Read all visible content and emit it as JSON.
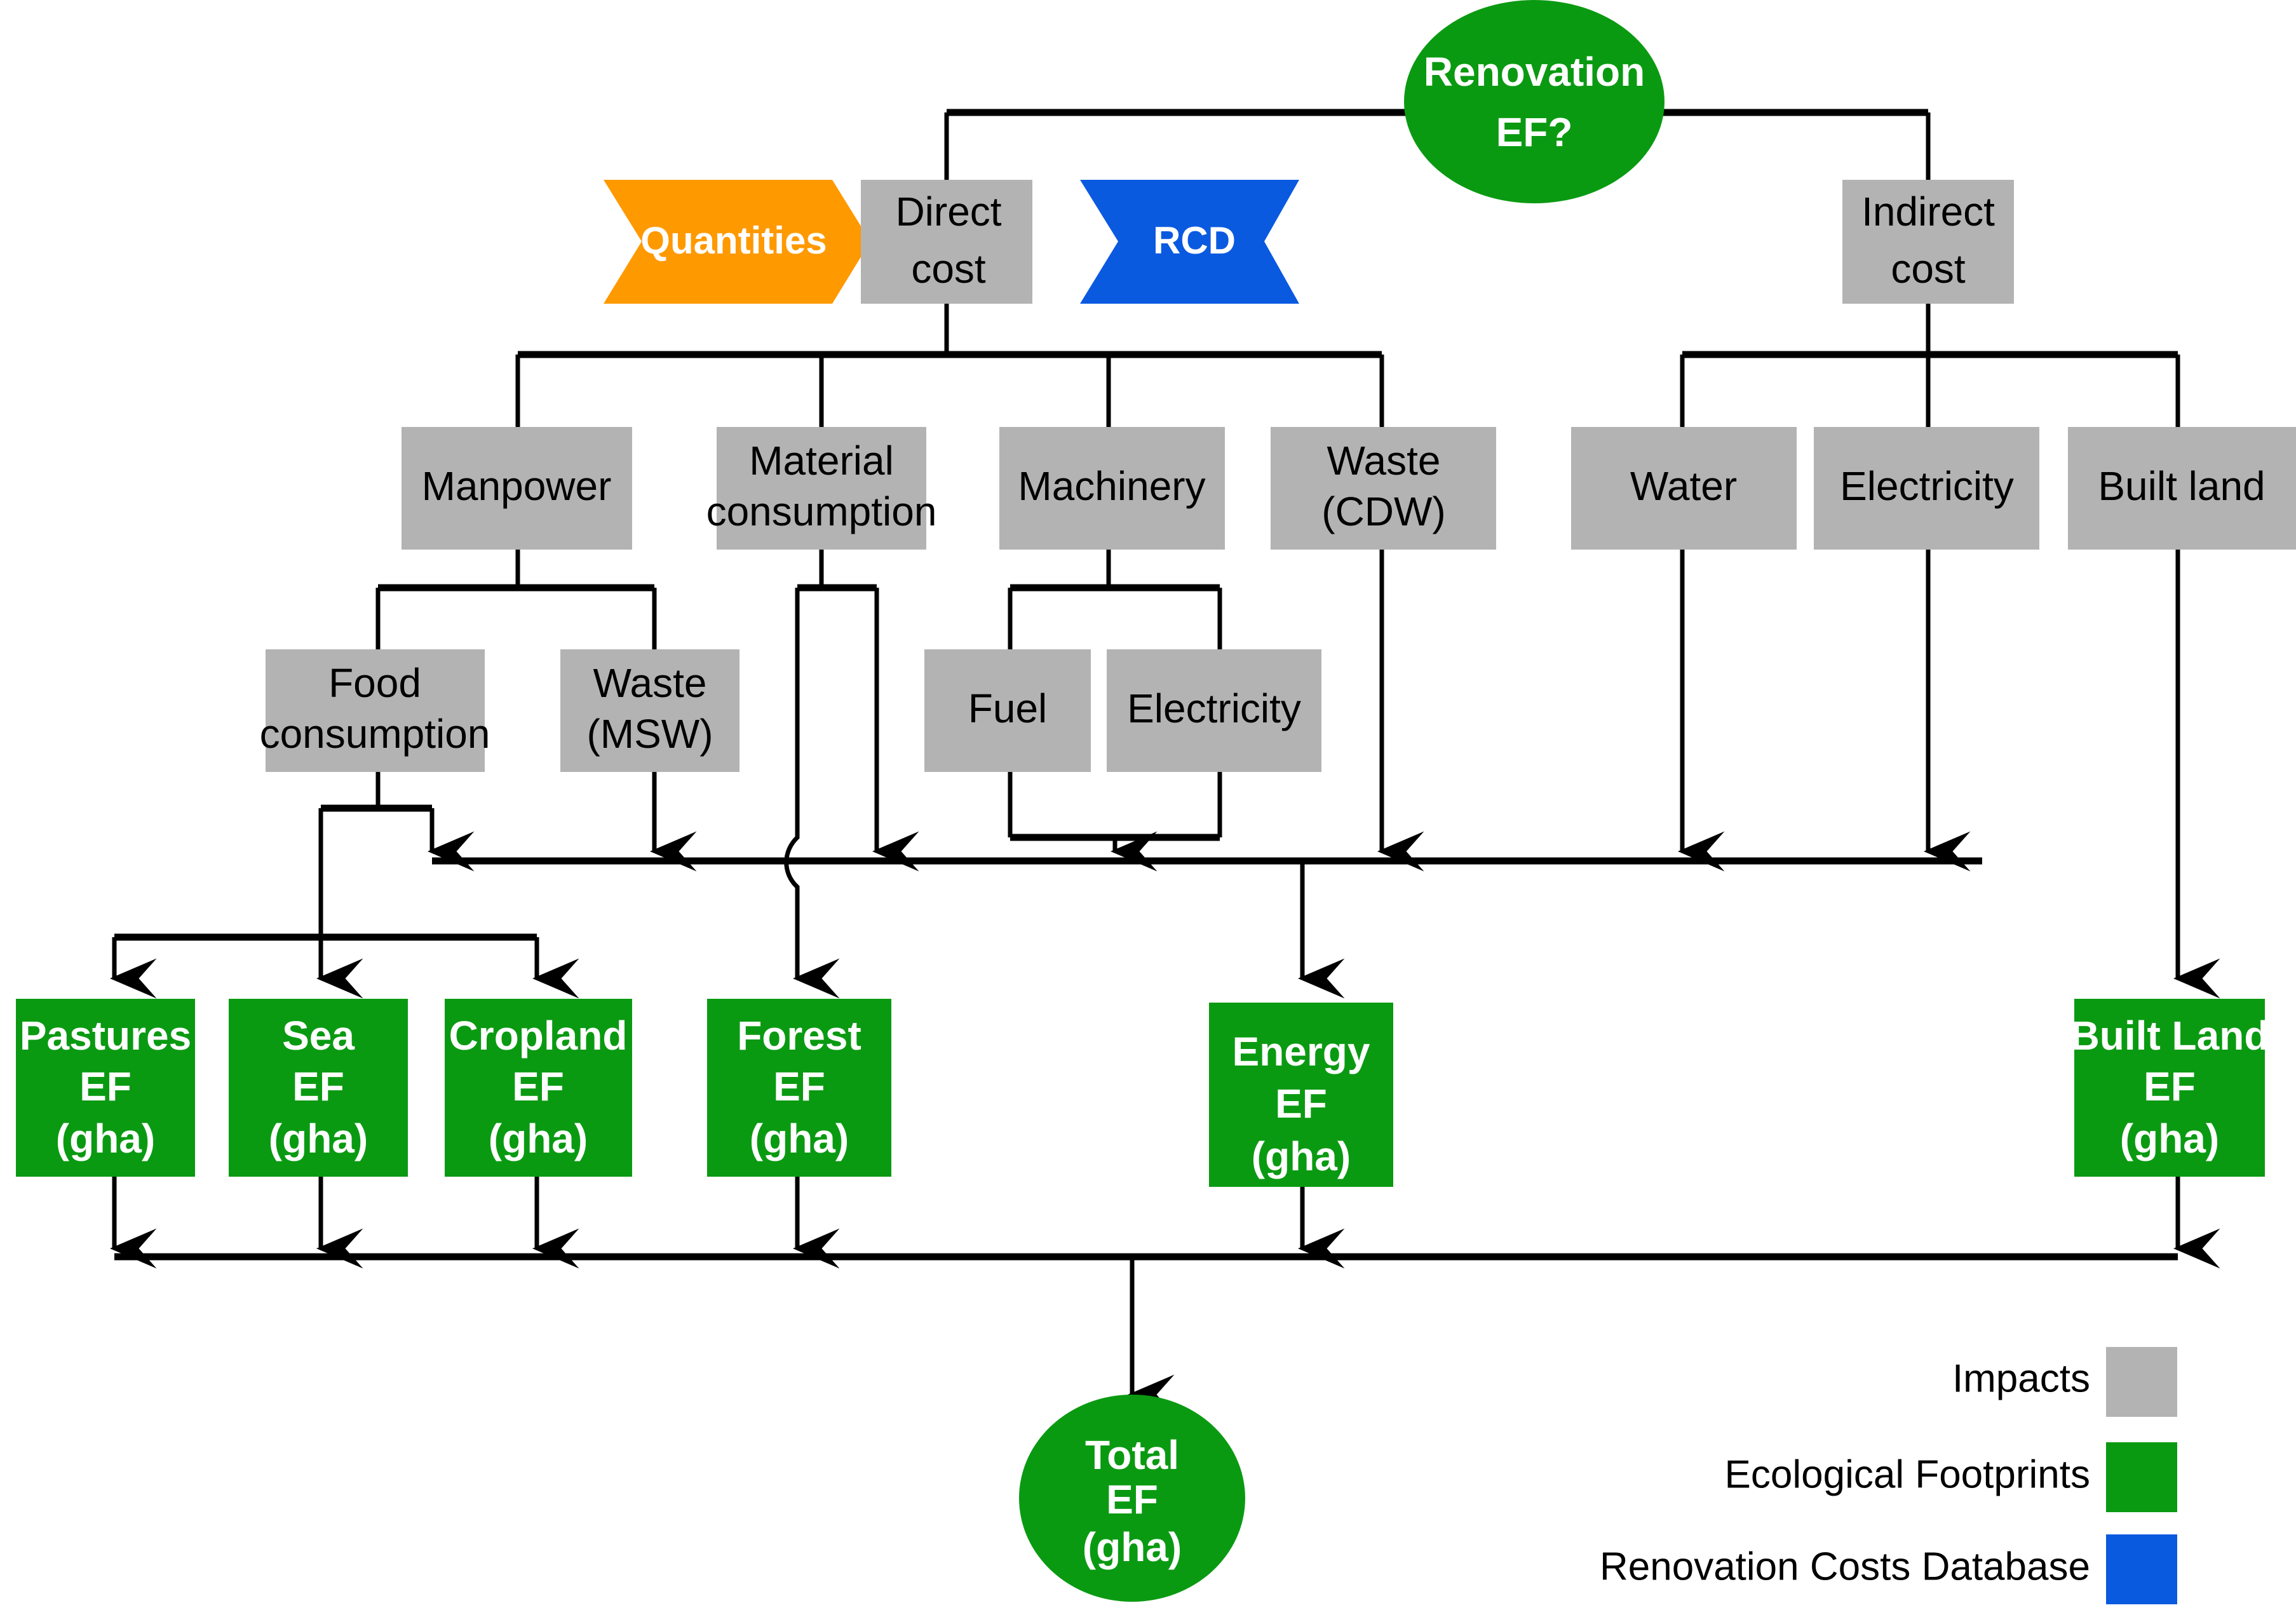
{
  "diagram": {
    "title": "Renovation Ecological Footprint calculation flowchart",
    "colors": {
      "impacts_gray": "#b3b3b3",
      "footprint_green": "#0a9a12",
      "database_blue": "#0a5ae0",
      "quantities_orange": "#ff9900",
      "line_black": "#000000",
      "text_white": "#ffffff",
      "text_black": "#000000"
    },
    "root": {
      "label_line1": "Renovation",
      "label_line2": "EF?"
    },
    "inputs": {
      "quantities": "Quantities",
      "rcd": "RCD"
    },
    "cost_nodes": [
      {
        "id": "direct-cost",
        "line1": "Direct",
        "line2": "cost"
      },
      {
        "id": "indirect-cost",
        "line1": "Indirect",
        "line2": "cost"
      }
    ],
    "direct_children": [
      {
        "id": "manpower",
        "line1": "Manpower",
        "line2": ""
      },
      {
        "id": "material-consumption",
        "line1": "Material",
        "line2": "consumption"
      },
      {
        "id": "machinery",
        "line1": "Machinery",
        "line2": ""
      },
      {
        "id": "waste-cdw",
        "line1": "Waste",
        "line2": "(CDW)"
      }
    ],
    "indirect_children": [
      {
        "id": "water",
        "line1": "Water",
        "line2": ""
      },
      {
        "id": "electricity-indirect",
        "line1": "Electricity",
        "line2": ""
      },
      {
        "id": "built-land",
        "line1": "Built land",
        "line2": ""
      }
    ],
    "manpower_children": [
      {
        "id": "food-consumption",
        "line1": "Food",
        "line2": "consumption"
      },
      {
        "id": "waste-msw",
        "line1": "Waste",
        "line2": "(MSW)"
      }
    ],
    "machinery_children": [
      {
        "id": "fuel",
        "line1": "Fuel",
        "line2": ""
      },
      {
        "id": "electricity-machinery",
        "line1": "Electricity",
        "line2": ""
      }
    ],
    "footprints": [
      {
        "id": "pastures-ef",
        "line1": "Pastures",
        "line2": "EF",
        "line3": "(gha)"
      },
      {
        "id": "sea-ef",
        "line1": "Sea",
        "line2": "EF",
        "line3": "(gha)"
      },
      {
        "id": "cropland-ef",
        "line1": "Cropland",
        "line2": "EF",
        "line3": "(gha)"
      },
      {
        "id": "forest-ef",
        "line1": "Forest",
        "line2": "EF",
        "line3": "(gha)"
      },
      {
        "id": "energy-ef",
        "line1": "Energy",
        "line2": "EF",
        "line3": "(gha)"
      },
      {
        "id": "built-land-ef",
        "line1": "Built Land",
        "line2": "EF",
        "line3": "(gha)"
      }
    ],
    "total": {
      "line1": "Total",
      "line2": "EF",
      "line3": "(gha)"
    },
    "legend": [
      {
        "id": "legend-impacts",
        "label": "Impacts",
        "color": "#b3b3b3"
      },
      {
        "id": "legend-ecological-footprints",
        "label": "Ecological Footprints",
        "color": "#0a9a12"
      },
      {
        "id": "legend-renovation-costs-database",
        "label": "Renovation Costs Database",
        "color": "#0a5ae0"
      }
    ]
  }
}
